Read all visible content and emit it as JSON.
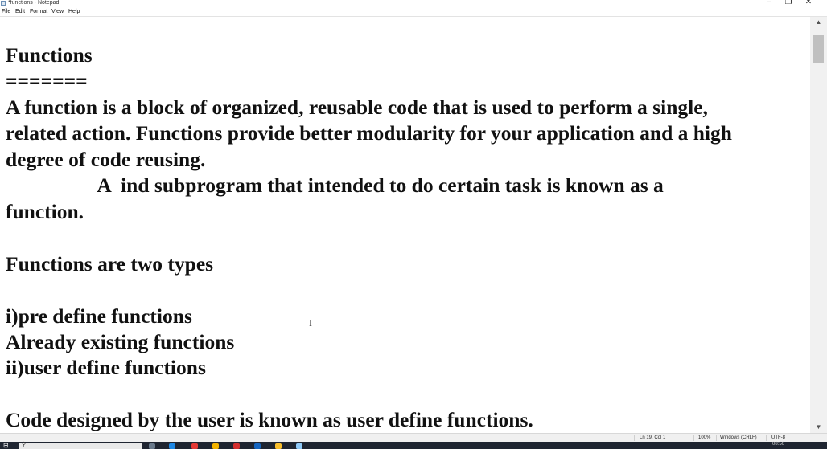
{
  "window": {
    "title": "*functions - Notepad",
    "controls": {
      "minimize": "–",
      "maximize": "❐",
      "close": "✕"
    }
  },
  "menu": [
    "File",
    "Edit",
    "Format",
    "View",
    "Help"
  ],
  "editor": {
    "lines": [
      "Functions",
      "=======",
      "A function is a block of organized, reusable code that is used to perform a single,",
      "related action. Functions provide better modularity for your application and a high",
      "degree of code reusing.",
      "                  A  ind subprogram that intended to do certain task is known as a",
      "function.",
      "",
      "Functions are two types",
      "",
      "i)pre define functions",
      "Already existing functions",
      "ii)user define functions",
      "",
      "Code designed by the user is known as user define functions."
    ]
  },
  "status": {
    "position": "Ln 19, Col 1",
    "zoom": "100%",
    "line_ending": "Windows (CRLF)",
    "encoding": "UTF-8"
  },
  "taskbar": {
    "time": "08:50"
  },
  "colors": {
    "taskbar": "#1f2531",
    "text": "#111111",
    "statusbar": "#f0f0f0"
  }
}
